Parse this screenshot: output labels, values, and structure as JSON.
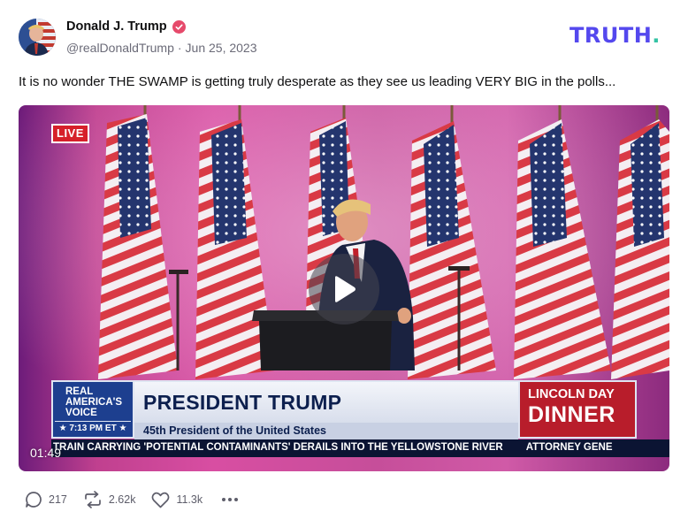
{
  "post": {
    "display_name": "Donald J. Trump",
    "handle": "@realDonaldTrump",
    "separator": "·",
    "date": "Jun 25, 2023",
    "text": "It is no wonder THE SWAMP is getting truly desperate as they see us leading VERY BIG in the polls...",
    "verified_color": "#e64a6b"
  },
  "brand": {
    "name": "TRUTH",
    "dot": ".",
    "color": "#5448ee",
    "dot_color": "#33c3a4"
  },
  "video": {
    "live_badge": "LIVE",
    "duration": "01:49",
    "logo_line1": "REAL",
    "logo_line2": "AMERICA'S",
    "logo_line3": "VOICE",
    "logo_time": "★ 7:13 PM ET ★",
    "headline": "PRESIDENT TRUMP",
    "subline": "45th President of the United States",
    "event_line1": "LINCOLN DAY",
    "event_line2": "DINNER",
    "ticker_main": "TRAIN CARRYING 'POTENTIAL CONTAMINANTS' DERAILS INTO THE YELLOWSTONE RIVER",
    "ticker_next": "ATTORNEY GENE"
  },
  "actions": {
    "replies": "217",
    "retruths": "2.62k",
    "likes": "11.3k"
  },
  "icons": [
    "verified-check-icon",
    "play-icon",
    "reply-icon",
    "retruth-icon",
    "heart-icon",
    "more-icon"
  ]
}
